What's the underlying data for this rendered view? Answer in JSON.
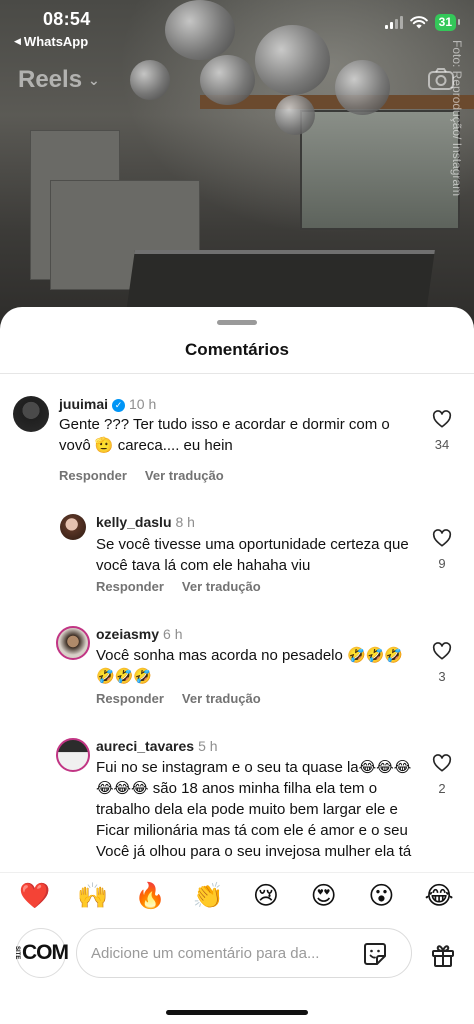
{
  "status_bar": {
    "time": "08:54",
    "back_app": "WhatsApp",
    "battery": "31"
  },
  "reel": {
    "title": "Reels",
    "credit": "Foto: Reprodução/ Instagram"
  },
  "sheet": {
    "title": "Comentários"
  },
  "comments": [
    {
      "username": "juuimai",
      "verified": true,
      "time": "10 h",
      "text": "Gente ??? Ter tudo isso e acordar e dormir com o vovô 🫡 careca.... eu hein",
      "reply_label": "Responder",
      "translate_label": "Ver tradução",
      "likes": "34"
    },
    {
      "username": "kelly_daslu",
      "time": "8 h",
      "text": "Se você tivesse uma oportunidade certeza que você tava lá com ele hahaha viu",
      "reply_label": "Responder",
      "translate_label": "Ver tradução",
      "likes": "9"
    },
    {
      "username": "ozeiasmy",
      "time": "6 h",
      "text": "Você sonha mas acorda no pesadelo 🤣🤣🤣🤣🤣🤣",
      "reply_label": "Responder",
      "translate_label": "Ver tradução",
      "likes": "3"
    },
    {
      "username": "aureci_tavares",
      "time": "5 h",
      "text": "Fui no se instagram e o seu ta quase la😂😂😂😂😂😂 são 18 anos minha filha ela tem o trabalho dela ela pode muito bem largar ele e Ficar milionária mas tá com ele é amor e o seu Você já olhou para o seu invejosa mulher ela tá com ele e tá rica e tu tá com teu e tá pobre",
      "likes": "2"
    }
  ],
  "emoji_bar": [
    "❤️",
    "🙌",
    "🔥",
    "👏",
    "😢",
    "😍",
    "😮",
    "😂"
  ],
  "input": {
    "placeholder": "Adicione um comentário para da...",
    "avatar_text": "COM",
    "avatar_small": "SITE"
  },
  "colors": {
    "verified": "#0095f6",
    "battery": "#34c759",
    "secondary_text": "#737373"
  }
}
